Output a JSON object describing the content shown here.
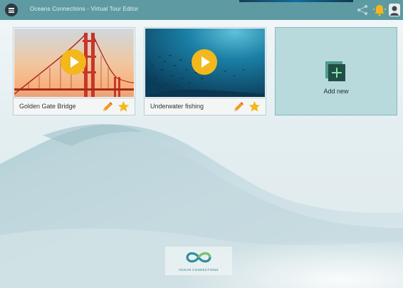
{
  "app": {
    "title": "Oceans Connections - Virtual Tour Editor"
  },
  "header": {
    "menu_icon": "hamburger-menu-icon",
    "share_icon": "share-icon",
    "notifications_icon": "bell-icon",
    "user_icon": "user-icon"
  },
  "tours": [
    {
      "title": "Golden Gate Bridge",
      "thumbnail": "golden-gate-bridge-photo",
      "play_icon": "play-icon",
      "edit_icon": "pencil-icon",
      "favorite_icon": "star-icon"
    },
    {
      "title": "Underwater fishing",
      "thumbnail": "underwater-fish-school-photo",
      "play_icon": "play-icon",
      "edit_icon": "pencil-icon",
      "favorite_icon": "star-icon"
    }
  ],
  "add_new": {
    "label": "Add new",
    "icon": "plus-icon"
  },
  "footer": {
    "logo_text": "OCEAN CONNECTIONS",
    "logo_icon": "infinity-logo-icon"
  },
  "colors": {
    "header": "#5e9aa1",
    "accent_yellow": "#f2b81c",
    "add_card": "#b8dadc",
    "add_icon": "#1f6f67"
  }
}
